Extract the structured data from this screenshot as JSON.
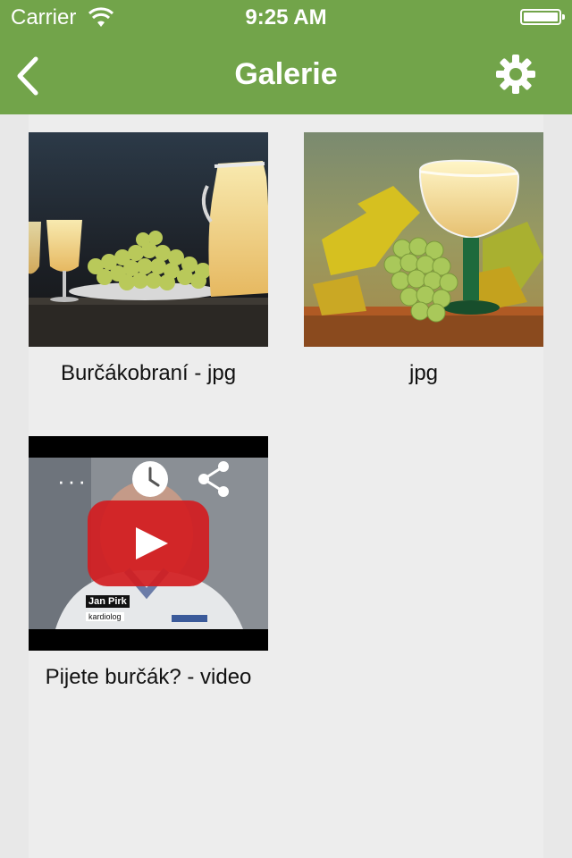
{
  "status_bar": {
    "carrier": "Carrier",
    "time": "9:25 AM"
  },
  "nav": {
    "title": "Galerie",
    "back_icon": "chevron-left-icon",
    "settings_icon": "gear-icon"
  },
  "colors": {
    "nav_bg": "#72a44a",
    "content_bg": "#ededed",
    "page_bg": "#e8e8e8"
  },
  "gallery": {
    "items": [
      {
        "caption": "Burčákobraní - jpg",
        "type": "image"
      },
      {
        "caption": "jpg",
        "type": "image"
      },
      {
        "caption": "Pijete burčák? - video",
        "type": "video",
        "overlay_name": "Jan Pirk",
        "overlay_role": "kardiolog"
      }
    ]
  }
}
